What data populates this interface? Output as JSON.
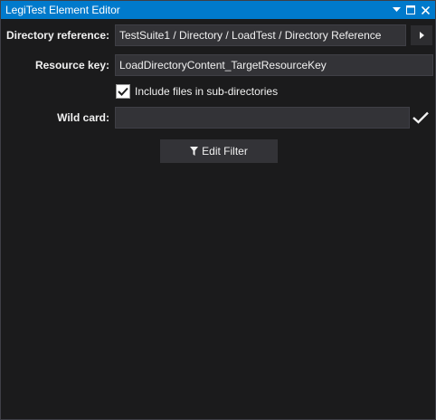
{
  "window": {
    "title": "LegiTest Element Editor",
    "accent_color": "#007acc",
    "controls": [
      "dropdown-icon",
      "maximize-icon",
      "close-icon"
    ]
  },
  "form": {
    "directory_reference": {
      "label": "Directory reference:",
      "value": "TestSuite1 / Directory / LoadTest / Directory Reference"
    },
    "resource_key": {
      "label": "Resource key:",
      "value": "LoadDirectoryContent_TargetResourceKey"
    },
    "include_subdirs": {
      "label": "Include files in sub-directories",
      "checked": true
    },
    "wild_card": {
      "label": "Wild card:",
      "value": ""
    },
    "edit_filter": {
      "label": "Edit Filter"
    }
  }
}
